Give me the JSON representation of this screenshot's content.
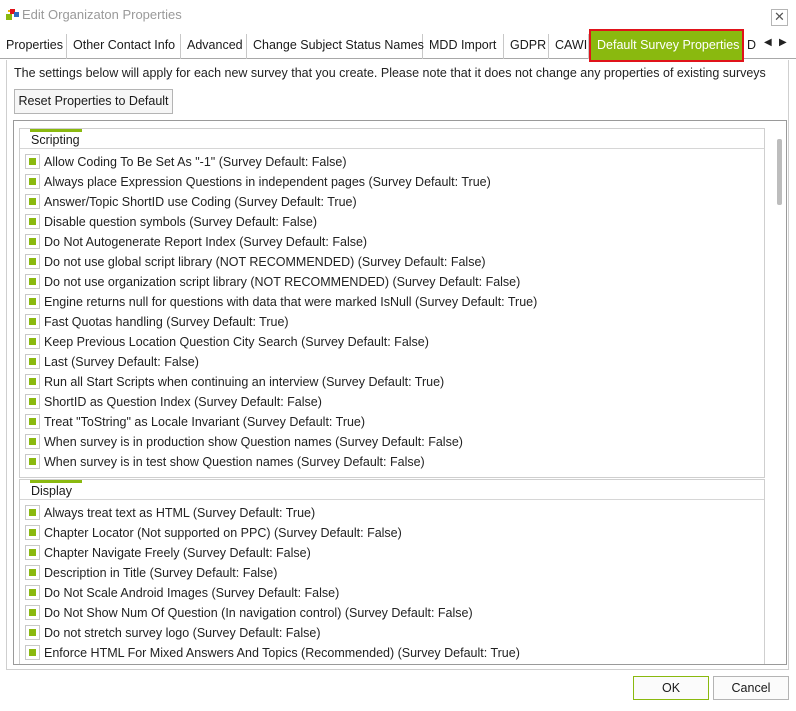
{
  "window": {
    "title": "Edit Organizaton Properties",
    "close_glyph": "✕"
  },
  "tabs": [
    "Properties",
    "Other Contact Info",
    "Advanced",
    "Change Subject Status Names",
    "MDD Import",
    "GDPR",
    "CAWI",
    "Default Survey Properties",
    "D"
  ],
  "tab_scroll": {
    "left_glyph": "◀",
    "right_glyph": "▶"
  },
  "info_text": "The settings below will apply for each new survey that you create. Please note that it does not change any properties of existing surveys",
  "reset_button": "Reset Properties to Default",
  "groups": [
    {
      "title": "Scripting",
      "items": [
        "Allow Coding To Be Set As \"-1\" (Survey Default: False)",
        "Always place Expression Questions in independent pages (Survey Default: True)",
        "Answer/Topic ShortID use Coding (Survey Default: True)",
        "Disable question symbols (Survey Default: False)",
        "Do Not Autogenerate Report Index (Survey Default: False)",
        "Do not use global script library (NOT RECOMMENDED) (Survey Default: False)",
        "Do not use organization script library (NOT RECOMMENDED) (Survey Default: False)",
        "Engine returns null for questions with data that were marked IsNull (Survey Default: True)",
        "Fast Quotas handling (Survey Default: True)",
        "Keep Previous Location Question City Search (Survey Default: False)",
        "Last (Survey Default: False)",
        "Run all Start Scripts when continuing an interview (Survey Default: True)",
        "ShortID as Question Index (Survey Default: False)",
        "Treat \"ToString\" as Locale Invariant (Survey Default: True)",
        "When survey is in production show Question names (Survey Default: False)",
        "When survey is in test show Question names (Survey Default: False)"
      ]
    },
    {
      "title": "Display",
      "items": [
        "Always treat text as HTML (Survey Default: True)",
        "Chapter Locator (Not supported on PPC) (Survey Default: False)",
        "Chapter Navigate Freely (Survey Default: False)",
        "Description in Title (Survey Default: False)",
        "Do Not Scale Android Images (Survey Default: False)",
        "Do Not Show Num Of Question (In navigation control) (Survey Default: False)",
        "Do not stretch survey logo (Survey Default: False)",
        "Enforce HTML For Mixed Answers And Topics (Recommended) (Survey Default: True)"
      ]
    }
  ],
  "footer": {
    "ok": "OK",
    "cancel": "Cancel"
  },
  "colors": {
    "accent": "#8ab90f",
    "highlight_border": "#e0131a"
  },
  "icons": {
    "app": "app-icon",
    "close": "close-icon",
    "checkbox": "checkbox-icon"
  }
}
